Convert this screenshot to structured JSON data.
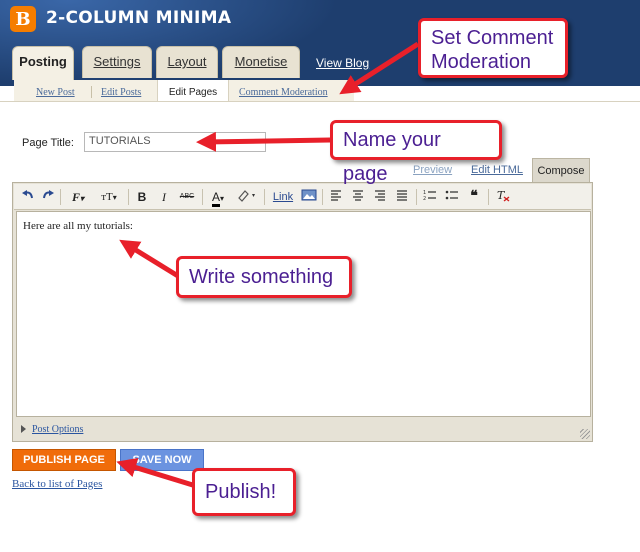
{
  "header": {
    "logo_letter": "B",
    "blog_title": "2-COLUMN MINIMA",
    "view_blog": "View Blog",
    "colors": {
      "header_bg": "#1e3e6e",
      "logo": "#f57d00"
    }
  },
  "tabs": [
    {
      "label": "Posting",
      "active": true
    },
    {
      "label": "Settings",
      "active": false
    },
    {
      "label": "Layout",
      "active": false
    },
    {
      "label": "Monetise",
      "active": false
    }
  ],
  "subtabs": [
    {
      "label": "New Post",
      "active": false
    },
    {
      "label": "Edit Posts",
      "active": false
    },
    {
      "label": "Edit Pages",
      "active": true
    },
    {
      "label": "Comment Moderation",
      "active": false
    }
  ],
  "page_title": {
    "label": "Page Title:",
    "value": "TUTORIALS"
  },
  "editor": {
    "modes": {
      "preview": "Preview",
      "edit_html": "Edit HTML",
      "compose": "Compose"
    },
    "toolbar": {
      "undo_icon": "undo-icon",
      "redo_icon": "redo-icon",
      "font_icon": "font-family-icon",
      "font_glyph": "F",
      "size_glyph": "тT",
      "bold": "B",
      "italic": "I",
      "strike": "ABC",
      "text_color_glyph": "A",
      "link": "Link"
    },
    "content": "Here are all my tutorials:",
    "post_options": "Post Options"
  },
  "buttons": {
    "publish": "PUBLISH PAGE",
    "save": "SAVE NOW",
    "back": "Back to list of Pages"
  },
  "annotations": {
    "comment_moderation": "Set Comment Moderation",
    "name_page": "Name your page",
    "write": "Write something",
    "publish": "Publish!"
  }
}
